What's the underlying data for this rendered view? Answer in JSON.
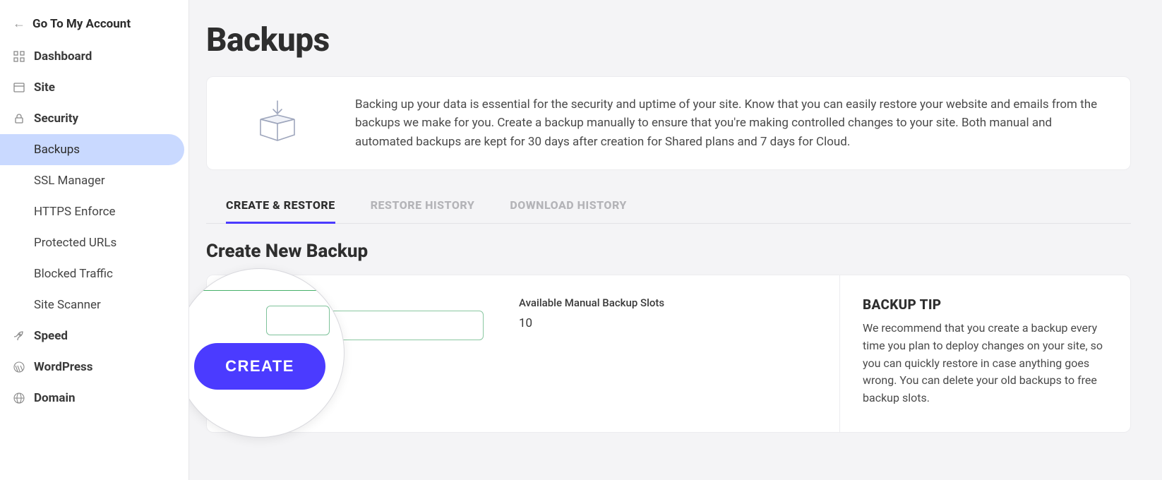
{
  "sidebar": {
    "top_link_label": "Go To My Account",
    "items": [
      {
        "label": "Dashboard"
      },
      {
        "label": "Site"
      },
      {
        "label": "Security"
      },
      {
        "label": "Speed"
      },
      {
        "label": "WordPress"
      },
      {
        "label": "Domain"
      }
    ],
    "security_subitems": [
      {
        "label": "Backups",
        "active": true
      },
      {
        "label": "SSL Manager"
      },
      {
        "label": "HTTPS Enforce"
      },
      {
        "label": "Protected URLs"
      },
      {
        "label": "Blocked Traffic"
      },
      {
        "label": "Site Scanner"
      }
    ]
  },
  "page": {
    "title": "Backups",
    "info_description": "Backing up your data is essential for the security and uptime of your site. Know that you can easily restore your website and emails from the backups we make for you. Create a backup manually to ensure that you're making controlled changes to your site. Both manual and automated backups are kept for 30 days after creation for Shared plans and 7 days for Cloud."
  },
  "tabs": [
    {
      "label": "CREATE & RESTORE",
      "active": true
    },
    {
      "label": "RESTORE HISTORY"
    },
    {
      "label": "DOWNLOAD HISTORY"
    }
  ],
  "create_section": {
    "title": "Create New Backup",
    "slots_label": "Available Manual Backup Slots",
    "slots_value": "10",
    "create_button_label": "CREATE",
    "tip_title": "BACKUP TIP",
    "tip_text": "We recommend that you create a backup every time you plan to deploy changes on your site, so you can quickly restore in case anything goes wrong. You can delete your old backups to free backup slots."
  }
}
